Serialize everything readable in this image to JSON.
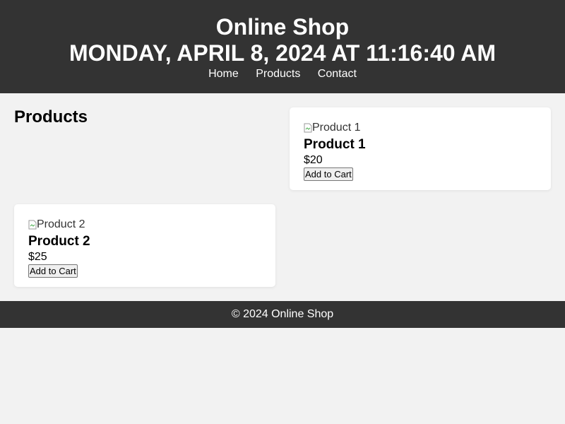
{
  "header": {
    "title": "Online Shop",
    "datetime": "Monday, April 8, 2024 at 11:16:40 AM"
  },
  "nav": {
    "items": [
      "Home",
      "Products",
      "Contact"
    ]
  },
  "main": {
    "heading": "Products",
    "products": [
      {
        "image_alt": "Product 1",
        "name": "Product 1",
        "price": "$20",
        "button": "Add to Cart"
      },
      {
        "image_alt": "Product 2",
        "name": "Product 2",
        "price": "$25",
        "button": "Add to Cart"
      }
    ]
  },
  "footer": {
    "text": "© 2024 Online Shop"
  },
  "colors": {
    "header_bg": "#333333",
    "page_bg": "#f2f2f2",
    "card_bg": "#ffffff"
  },
  "icons": {
    "broken_image": "broken-image-icon"
  }
}
